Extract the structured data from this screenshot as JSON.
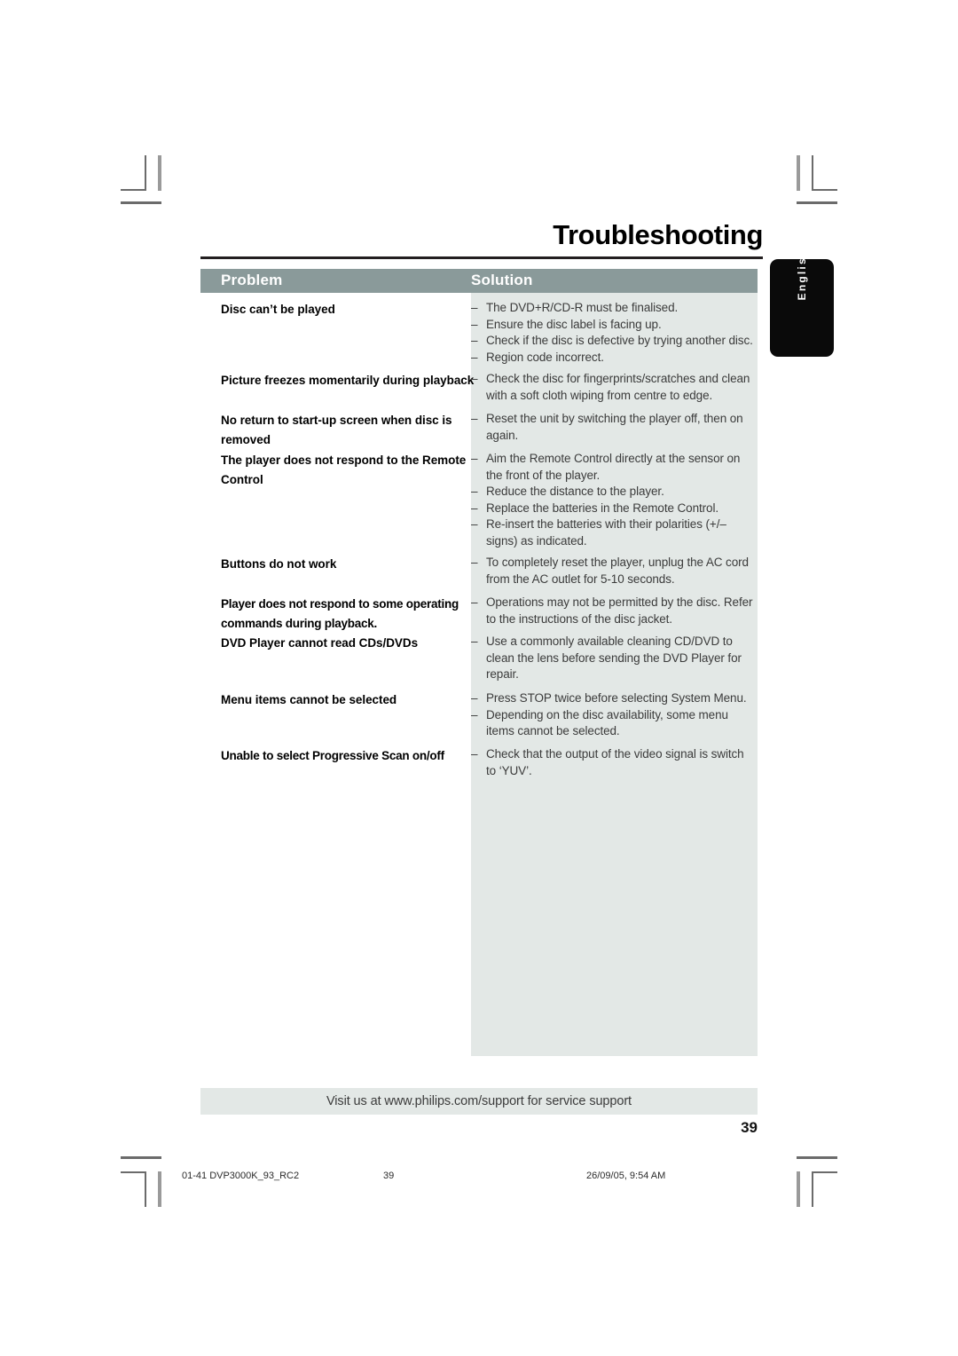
{
  "document": {
    "title": "Troubleshooting",
    "page_number": "39"
  },
  "table": {
    "headers": {
      "problem": "Problem",
      "solution": "Solution"
    },
    "rows": [
      {
        "problem": "Disc can’t be played",
        "solutions": [
          "The DVD+R/CD-R must be finalised.",
          "Ensure the disc label is facing up.",
          "Check if the disc is defective by trying another disc.",
          "Region code incorrect."
        ]
      },
      {
        "problem": "Picture freezes momentarily during playback",
        "solutions": [
          "Check the disc for fingerprints/scratches and clean with a soft cloth wiping from centre to edge."
        ]
      },
      {
        "problem": "No return to start-up screen when disc is removed",
        "solutions": [
          "Reset the unit by switching the player off, then on again."
        ]
      },
      {
        "problem": "The player does not respond to the Remote Control",
        "solutions": [
          "Aim the Remote Control directly at the sensor on the front of the player.",
          "Reduce the distance to the player.",
          "Replace the batteries in the Remote Control.",
          "Re-insert the batteries with their polarities (+/– signs) as indicated."
        ]
      },
      {
        "problem": "Buttons do not work",
        "solutions": [
          "To completely reset the player, unplug the AC cord from the AC outlet for 5-10 seconds."
        ]
      },
      {
        "problem": "Player does not respond to some operating commands during playback.",
        "solutions": [
          "Operations may not be permitted by the disc. Refer to the instructions of  the disc jacket."
        ]
      },
      {
        "problem": "DVD Player cannot read CDs/DVDs",
        "solutions": [
          "Use a commonly available cleaning CD/DVD to clean the lens before sending the DVD Player for repair."
        ]
      },
      {
        "problem": "Menu items cannot be selected",
        "solutions": [
          "Press STOP twice before selecting System Menu.",
          "Depending on the disc availability, some menu items cannot be selected."
        ]
      },
      {
        "problem": "Unable to select Progressive Scan on/off",
        "solutions": [
          "Check that the output of the video signal is switch to ‘YUV’."
        ]
      }
    ]
  },
  "side_tab": {
    "language": "English"
  },
  "support_banner": {
    "text": "Visit us at www.philips.com/support for service support"
  },
  "print_footer": {
    "file": "01-41 DVP3000K_93_RC2",
    "page": "39",
    "timestamp": "26/09/05, 9:54 AM"
  },
  "colors": {
    "header_band": "#8a9a9a",
    "solution_shade": "#e3e8e6",
    "rule": "#231f20",
    "tab_background": "#0a0a0a"
  },
  "bullet_dash": "–"
}
